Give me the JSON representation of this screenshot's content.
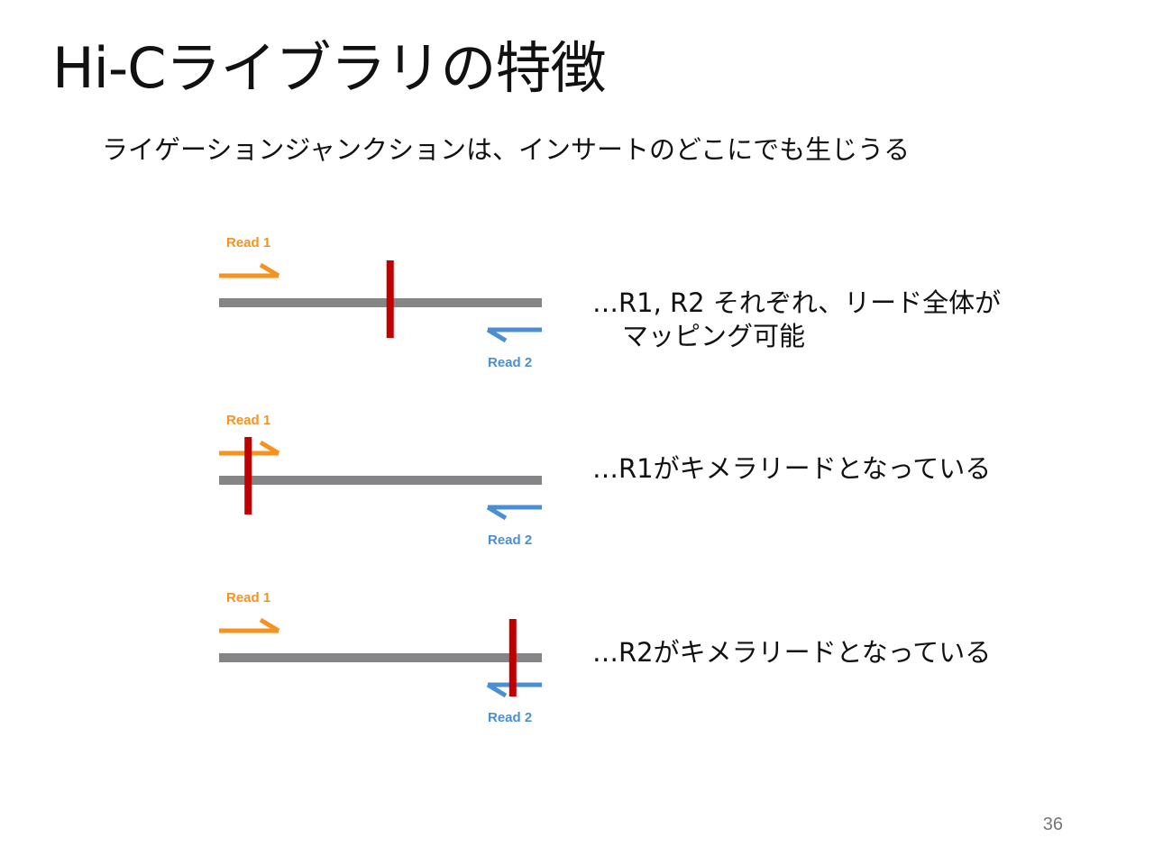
{
  "title": "Hi-Cライブラリの特徴",
  "subtitle": "ライゲーションジャンクションは、インサートのどこにでも生じうる",
  "colors": {
    "read1": "#f6921e",
    "read2": "#4a8fd4",
    "insert": "#858587",
    "junction": "#c00000"
  },
  "diagrams": [
    {
      "read1_label": "Read 1",
      "read2_label": "Read 2",
      "junction_fraction": 0.53,
      "description_line1": "…R1, R2 それぞれ、リード全体が",
      "description_line2": "マッピング可能"
    },
    {
      "read1_label": "Read 1",
      "read2_label": "Read 2",
      "junction_fraction": 0.09,
      "description_line1": "…R1がキメラリードとなっている",
      "description_line2": ""
    },
    {
      "read1_label": "Read 1",
      "read2_label": "Read 2",
      "junction_fraction": 0.91,
      "description_line1": "…R2がキメラリードとなっている",
      "description_line2": ""
    }
  ],
  "page_number": "36"
}
